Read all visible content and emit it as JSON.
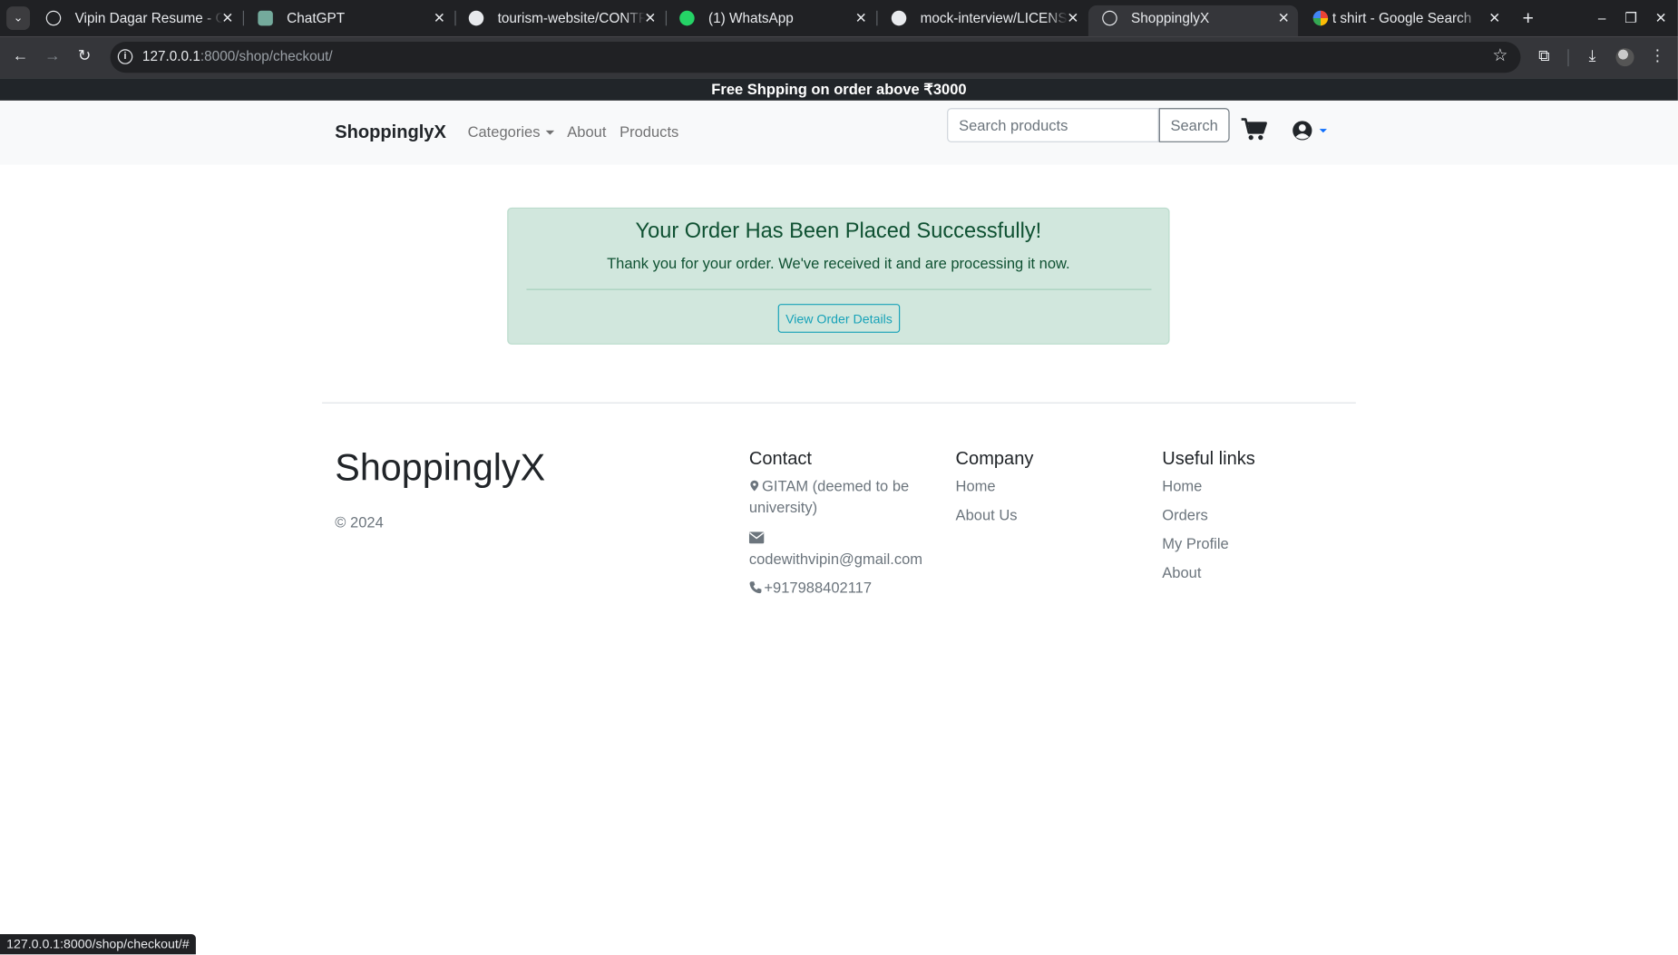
{
  "browser": {
    "tabs": [
      {
        "title": "Vipin Dagar Resume - Google Docs",
        "favicon": "globe-icon",
        "active": false
      },
      {
        "title": "ChatGPT",
        "favicon": "chatgpt-icon",
        "active": false
      },
      {
        "title": "tourism-website/CONTRIBUTING.md",
        "favicon": "github-icon",
        "active": false
      },
      {
        "title": "(1) WhatsApp",
        "favicon": "whatsapp-icon",
        "active": false
      },
      {
        "title": "mock-interview/LICENSE",
        "favicon": "github-icon",
        "active": false
      },
      {
        "title": "ShoppinglyX",
        "favicon": "globe-icon",
        "active": true
      },
      {
        "title": "t shirt - Google Search",
        "favicon": "google-icon",
        "active": false
      }
    ],
    "url_host": "127.0.0.1",
    "url_rest": ":8000/shop/checkout/",
    "status_url": "127.0.0.1:8000/shop/checkout/#"
  },
  "promo_banner": "Free Shpping on order above ₹3000",
  "navbar": {
    "brand": "ShoppinglyX",
    "links": {
      "categories": "Categories",
      "about": "About",
      "products": "Products"
    },
    "search_placeholder": "Search products",
    "search_button": "Search"
  },
  "alert": {
    "heading": "Your Order Has Been Placed Successfully!",
    "message": "Thank you for your order. We've received it and are processing it now.",
    "button": "View Order Details"
  },
  "footer": {
    "brand": "ShoppinglyX",
    "copyright": "© 2024",
    "contact": {
      "heading": "Contact",
      "address": "GITAM (deemed to be university)",
      "email": "codewithvipin@gmail.com",
      "phone": "+917988402117"
    },
    "company": {
      "heading": "Company",
      "links": [
        "Home",
        "About Us"
      ]
    },
    "useful": {
      "heading": "Useful links",
      "links": [
        "Home",
        "Orders",
        "My Profile",
        "About"
      ]
    }
  },
  "colors": {
    "success_bg": "#d1e7dd",
    "success_text": "#0f5132",
    "info": "#17a2b8",
    "promo_bg": "#212529"
  }
}
